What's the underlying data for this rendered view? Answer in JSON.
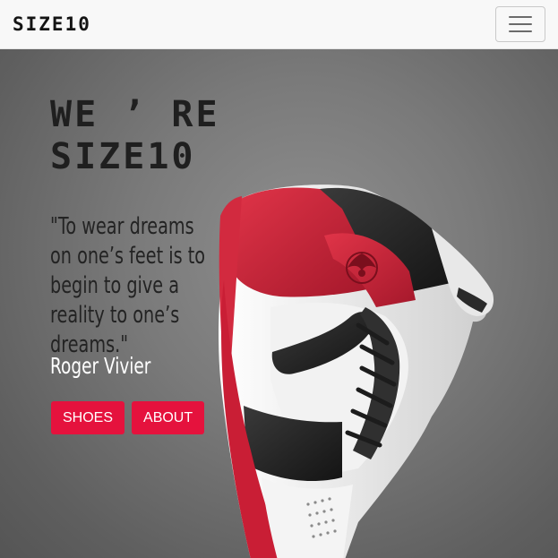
{
  "navbar": {
    "brand": "SIZE10",
    "toggler_icon": "hamburger-icon"
  },
  "hero": {
    "headline_line1": "WE ’ RE",
    "headline_line2": "SIZE10",
    "quote": "\"To wear dreams on one’s feet is to begin to give a reality to one’s dreams.\"",
    "author": "Roger Vivier",
    "buttons": [
      {
        "label": "SHOES"
      },
      {
        "label": "ABOUT"
      }
    ],
    "image": "high-top-sneaker-image",
    "colors": {
      "accent": "#e5123d",
      "sneaker_red": "#c81f36",
      "sneaker_black": "#252525",
      "sneaker_white": "#f1f1f1"
    }
  }
}
